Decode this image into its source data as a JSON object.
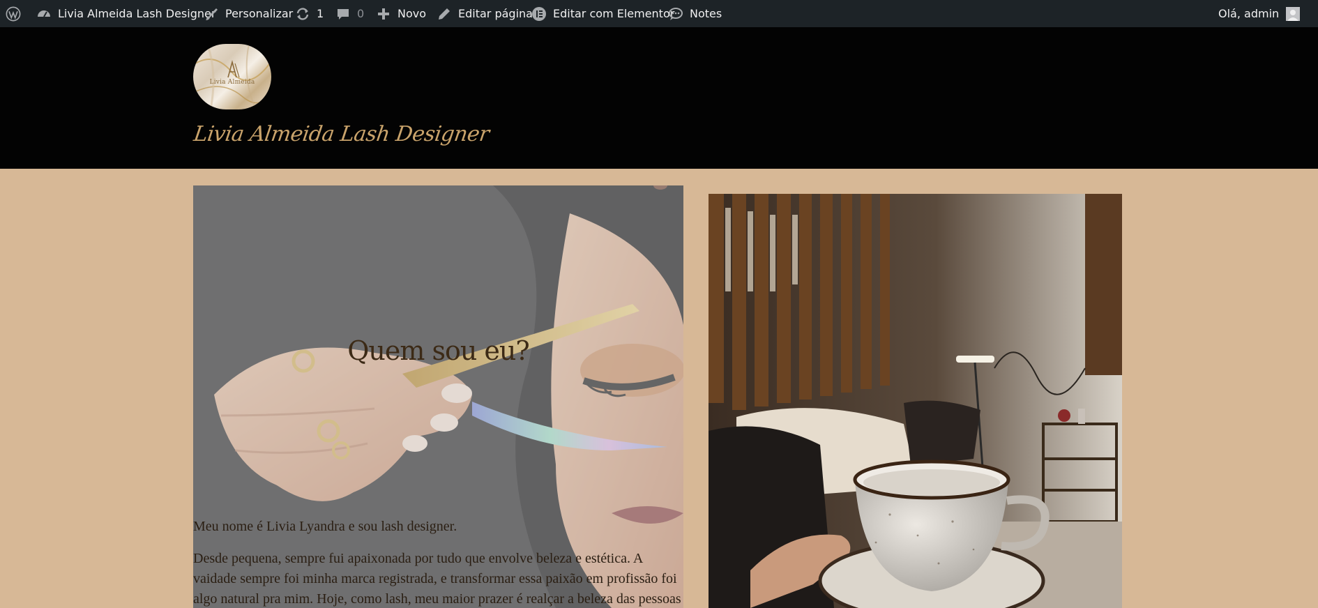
{
  "admin_bar": {
    "wp_logo_icon": "wordpress-icon",
    "site_name": "Livia Almeida Lash Designer",
    "customize": "Personalizar",
    "updates_count": "1",
    "comments_count": "0",
    "new": "Novo",
    "edit_page": "Editar página",
    "edit_elementor": "Editar com Elementor",
    "notes": "Notes",
    "greeting": "Olá, admin"
  },
  "header": {
    "logo_text": "Livia Almeida",
    "site_title": "Livia Almeida Lash Designer"
  },
  "about": {
    "heading": "Quem sou eu?",
    "paragraphs": [
      "Meu nome é Livia Lyandra e sou lash designer.",
      "Desde pequena, sempre fui apaixonada por tudo que envolve beleza e estética. A vaidade sempre foi minha marca registrada, e transformar essa paixão em profissão foi algo natural pra mim. Hoje, como lash, meu maior prazer é realçar a beleza das pessoas"
    ]
  },
  "colors": {
    "admin_bar_bg": "#1d2327",
    "header_bg": "#030303",
    "page_bg": "#d7b896",
    "title_gold": "#c9a36b",
    "heading_brown": "#3c2a16"
  }
}
